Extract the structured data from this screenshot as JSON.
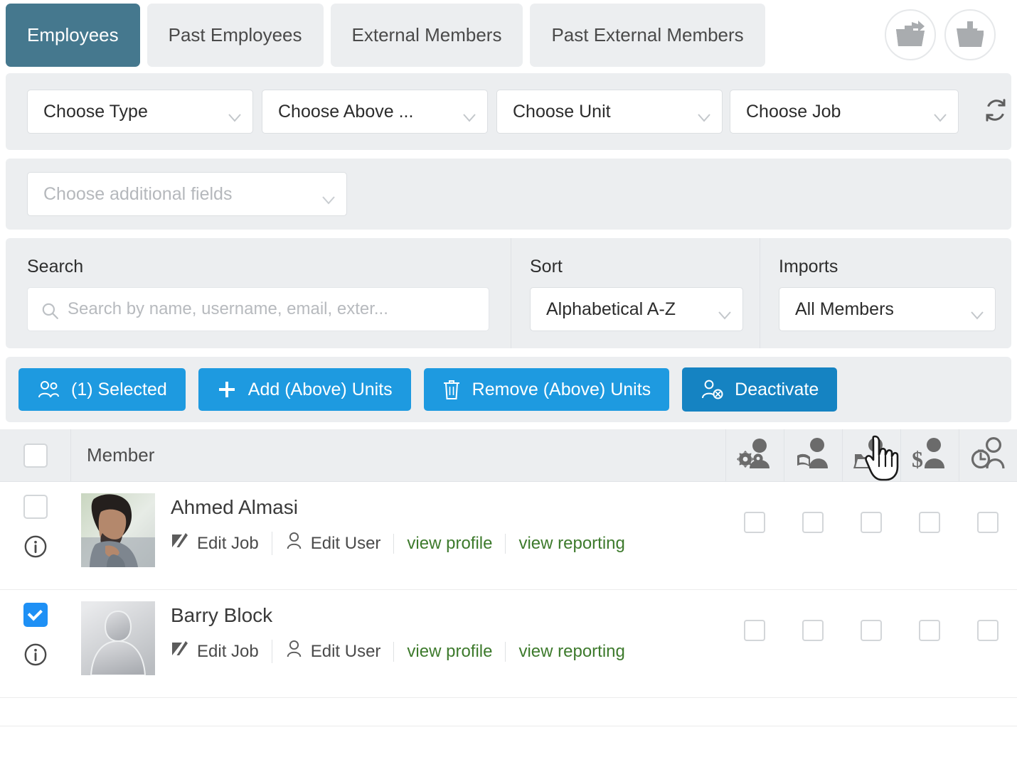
{
  "tabs": [
    {
      "label": "Employees",
      "active": true
    },
    {
      "label": "Past Employees",
      "active": false
    },
    {
      "label": "External Members",
      "active": false
    },
    {
      "label": "Past External Members",
      "active": false
    }
  ],
  "header_actions": [
    {
      "name": "export-folder-button",
      "icon": "folder-export-icon"
    },
    {
      "name": "import-folder-button",
      "icon": "folder-import-icon"
    }
  ],
  "filters": {
    "type": {
      "value": "Choose Type",
      "is_placeholder": false
    },
    "above": {
      "value": "Choose Above ...",
      "is_placeholder": false
    },
    "unit": {
      "value": "Choose Unit",
      "is_placeholder": false
    },
    "job": {
      "value": "Choose Job",
      "is_placeholder": false
    },
    "refresh_icon": "refresh-icon",
    "additional_fields": {
      "value": "Choose additional fields",
      "is_placeholder": true
    }
  },
  "search": {
    "label": "Search",
    "placeholder": "Search by name, username, email, exter...",
    "value": "",
    "icon": "search-icon"
  },
  "sort": {
    "label": "Sort",
    "value": "Alphabetical A-Z"
  },
  "imports": {
    "label": "Imports",
    "value": "All Members"
  },
  "actions": [
    {
      "label": "(1) Selected",
      "icon": "users-icon",
      "state": "normal"
    },
    {
      "label": "Add (Above) Units",
      "icon": "plus-icon",
      "state": "normal"
    },
    {
      "label": "Remove (Above) Units",
      "icon": "trash-icon",
      "state": "normal"
    },
    {
      "label": "Deactivate",
      "icon": "user-deactivate-icon",
      "state": "hover"
    }
  ],
  "table": {
    "select_all_checked": false,
    "member_column_label": "Member",
    "icon_columns": [
      "user-settings-icon",
      "user-learning-icon",
      "user-files-icon",
      "user-billing-icon",
      "user-time-icon"
    ],
    "rows": [
      {
        "name": "Ahmed Almasi",
        "selected": false,
        "avatar_type": "photo",
        "info_icon": "info-icon",
        "links": [
          {
            "label": "Edit Job",
            "icon": "edit-pencil-icon",
            "style": "dark"
          },
          {
            "label": "Edit User",
            "icon": "user-icon",
            "style": "dark"
          },
          {
            "label": "view profile",
            "icon": "",
            "style": "green"
          },
          {
            "label": "view reporting",
            "icon": "",
            "style": "green"
          }
        ],
        "column_checks": [
          false,
          false,
          false,
          false,
          false
        ]
      },
      {
        "name": "Barry Block",
        "selected": true,
        "avatar_type": "silhouette",
        "info_icon": "info-icon",
        "links": [
          {
            "label": "Edit Job",
            "icon": "edit-pencil-icon",
            "style": "dark"
          },
          {
            "label": "Edit User",
            "icon": "user-icon",
            "style": "dark"
          },
          {
            "label": "view profile",
            "icon": "",
            "style": "green"
          },
          {
            "label": "view reporting",
            "icon": "",
            "style": "green"
          }
        ],
        "column_checks": [
          false,
          false,
          false,
          false,
          false
        ]
      }
    ]
  },
  "colors": {
    "tab_active": "#45788e",
    "panel_bg": "#eceef0",
    "action_blue": "#1e9ae0",
    "action_blue_hover": "#1583c2",
    "checkbox_checked": "#1e90f5",
    "link_green": "#3d7a2c"
  },
  "cursor": {
    "type": "pointer-hand"
  }
}
